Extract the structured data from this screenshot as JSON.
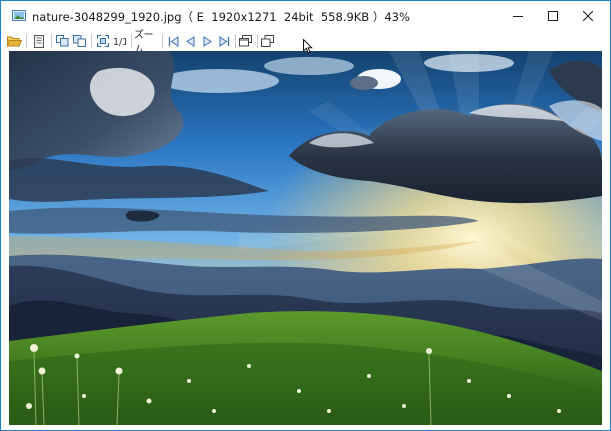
{
  "window": {
    "title": "nature-3048299_1920.jpg（ E  1920x1271  24bit  558.9KB ）43%"
  },
  "toolbar": {
    "zoom_label": "ズーム",
    "actual_size_label": "1/1"
  },
  "icons": {
    "app": "image-file-icon",
    "open": "open-folder-icon",
    "file": "document-icon",
    "fit": "fit-window-icon",
    "first": "first-image-icon",
    "prev": "previous-image-icon",
    "next": "next-image-icon",
    "last": "last-image-icon"
  },
  "colors": {
    "accent": "#1883d7",
    "icon_blue": "#3a6fb0",
    "folder": "#e8b43a"
  }
}
